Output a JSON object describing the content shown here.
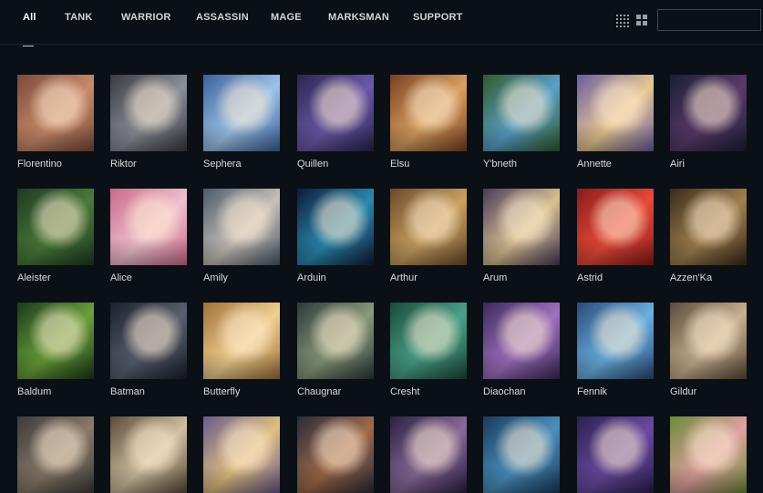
{
  "tabs": [
    {
      "id": "all",
      "label": "All"
    },
    {
      "id": "tank",
      "label": "TANK"
    },
    {
      "id": "warrior",
      "label": "WARRIOR"
    },
    {
      "id": "assassin",
      "label": "ASSASSIN"
    },
    {
      "id": "mage",
      "label": "MAGE"
    },
    {
      "id": "marksman",
      "label": "MARKSMAN"
    },
    {
      "id": "support",
      "label": "SUPPORT"
    }
  ],
  "active_tab": "All",
  "search": {
    "value": "",
    "placeholder": ""
  },
  "view_icons": [
    "grid-small-icon",
    "grid-large-icon"
  ],
  "heroes": [
    {
      "name": "Florentino",
      "colors": [
        "#7a4a3a",
        "#c98a6a"
      ]
    },
    {
      "name": "Riktor",
      "colors": [
        "#3a3a40",
        "#8a8f99"
      ]
    },
    {
      "name": "Sephera",
      "colors": [
        "#3b5f9c",
        "#9cc4e8"
      ]
    },
    {
      "name": "Quillen",
      "colors": [
        "#2a2450",
        "#6a5aa8"
      ]
    },
    {
      "name": "Elsu",
      "colors": [
        "#7a3f22",
        "#d9a060"
      ]
    },
    {
      "name": "Y'bneth",
      "colors": [
        "#2f5a2a",
        "#5aa0c8"
      ]
    },
    {
      "name": "Annette",
      "colors": [
        "#6a5ca0",
        "#e8c890"
      ]
    },
    {
      "name": "Airi",
      "colors": [
        "#1a1f35",
        "#5a3a6a"
      ]
    },
    {
      "name": "Aleister",
      "colors": [
        "#1c3a22",
        "#4a7a3a"
      ]
    },
    {
      "name": "Alice",
      "colors": [
        "#c86a8a",
        "#f0c0d0"
      ]
    },
    {
      "name": "Amily",
      "colors": [
        "#4a5a6a",
        "#c8c0b8"
      ]
    },
    {
      "name": "Arduin",
      "colors": [
        "#101a3a",
        "#2a8ab0"
      ]
    },
    {
      "name": "Arthur",
      "colors": [
        "#6a4a2a",
        "#c8a060"
      ]
    },
    {
      "name": "Arum",
      "colors": [
        "#4a3a5a",
        "#d8c090"
      ]
    },
    {
      "name": "Astrid",
      "colors": [
        "#8a1a1a",
        "#e84a3a"
      ]
    },
    {
      "name": "Azzen'Ka",
      "colors": [
        "#3a2a1a",
        "#a08050"
      ]
    },
    {
      "name": "Baldum",
      "colors": [
        "#1a3a1a",
        "#6aa03a"
      ]
    },
    {
      "name": "Batman",
      "colors": [
        "#1a1f2a",
        "#5a6070"
      ]
    },
    {
      "name": "Butterfly",
      "colors": [
        "#a0703a",
        "#f0d090"
      ]
    },
    {
      "name": "Chaugnar",
      "colors": [
        "#2a3a3a",
        "#8a9a7a"
      ]
    },
    {
      "name": "Cresht",
      "colors": [
        "#1a4a3a",
        "#4aa08a"
      ]
    },
    {
      "name": "Diaochan",
      "colors": [
        "#3a2a5a",
        "#a070c0"
      ]
    },
    {
      "name": "Fennik",
      "colors": [
        "#2a4a7a",
        "#6ab0e0"
      ]
    },
    {
      "name": "Gildur",
      "colors": [
        "#5a4a3a",
        "#c8b090"
      ]
    },
    {
      "name": "",
      "colors": [
        "#3a3a3a",
        "#8a7a6a"
      ]
    },
    {
      "name": "",
      "colors": [
        "#5a4a3a",
        "#d0c0a0"
      ]
    },
    {
      "name": "",
      "colors": [
        "#6a5a8a",
        "#e0c080"
      ]
    },
    {
      "name": "",
      "colors": [
        "#2a2a3a",
        "#a06a4a"
      ]
    },
    {
      "name": "",
      "colors": [
        "#2a2040",
        "#8a6a9a"
      ]
    },
    {
      "name": "",
      "colors": [
        "#1a3a5a",
        "#4a90c0"
      ]
    },
    {
      "name": "",
      "colors": [
        "#2a2050",
        "#6a4aa0"
      ]
    },
    {
      "name": "",
      "colors": [
        "#6a8a3a",
        "#e0a0a0"
      ]
    }
  ]
}
